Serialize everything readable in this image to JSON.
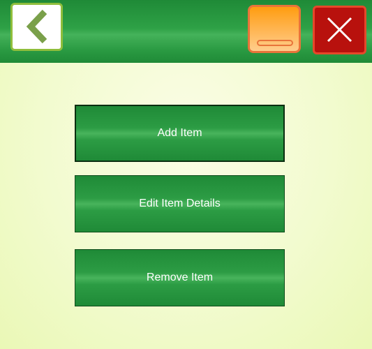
{
  "header": {
    "back_icon": "chevron-left-icon",
    "minimize_icon": "minimize-icon",
    "close_icon": "close-icon"
  },
  "menu": {
    "items": [
      {
        "label": "Add Item"
      },
      {
        "label": "Edit Item Details"
      },
      {
        "label": "Remove Item"
      }
    ]
  },
  "colors": {
    "header_green": "#2ea146",
    "back_border": "#8fbe3c",
    "chevron": "#7aa04a",
    "minimize_orange": "#ff9d10",
    "minimize_border": "#e8743a",
    "close_red": "#b8110d",
    "close_border": "#e6482a",
    "background": "#f2fbcf"
  }
}
